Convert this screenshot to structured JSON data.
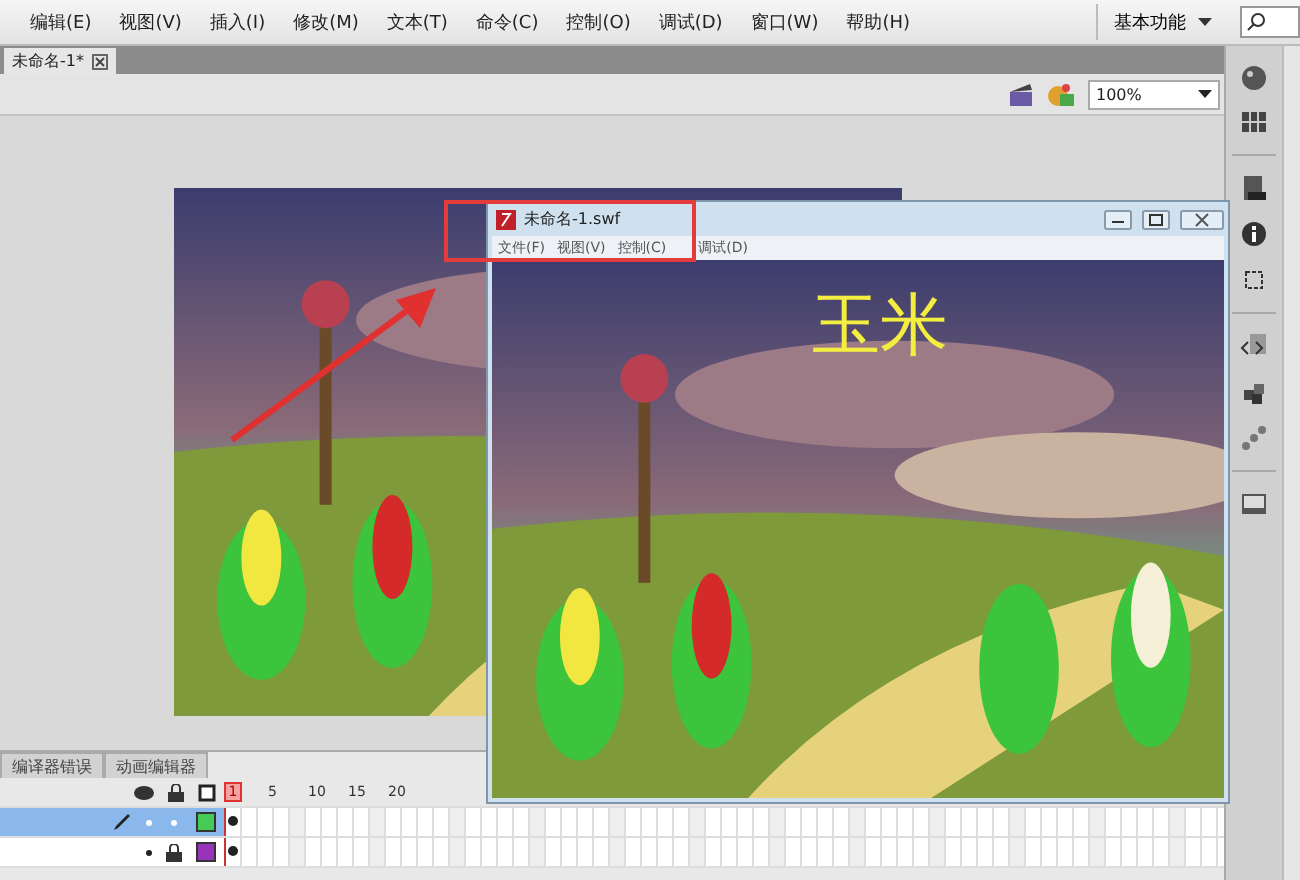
{
  "menu_bar": {
    "items": [
      "编辑(E)",
      "视图(V)",
      "插入(I)",
      "修改(M)",
      "文本(T)",
      "命令(C)",
      "控制(O)",
      "调试(D)",
      "窗口(W)",
      "帮助(H)"
    ],
    "workspace": "基本功能"
  },
  "document_tabs": [
    {
      "label": "未命名-1*",
      "selected": true
    }
  ],
  "toolbar": {
    "zoom": "100%"
  },
  "timeline": {
    "panel_tabs": [
      {
        "label": "编译器错误",
        "selected": false
      },
      {
        "label": "动画编辑器",
        "selected": false
      }
    ],
    "frame_numbers": [
      "1",
      "5",
      "10",
      "15",
      "20"
    ],
    "layers": [
      {
        "selected": true,
        "editing": true,
        "locked": false,
        "color": "#44cc55"
      },
      {
        "selected": false,
        "editing": false,
        "locked": true,
        "color": "#9933bb"
      }
    ]
  },
  "player_window": {
    "title": "未命名-1.swf",
    "menu": [
      "文件(F)",
      "视图(V)",
      "控制(C)",
      "调试(D)"
    ],
    "movie_text": "玉米"
  }
}
